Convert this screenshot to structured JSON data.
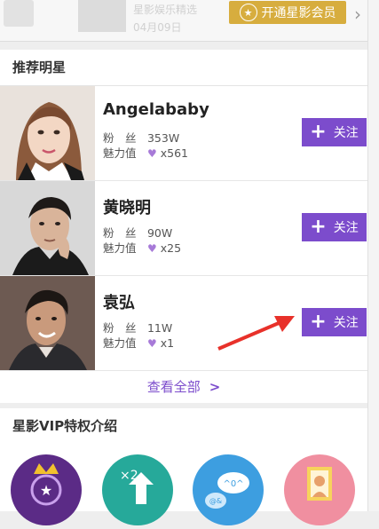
{
  "top": {
    "vip_button_label": "开通星影会员",
    "blurred_line1": "星影娱乐精选",
    "blurred_line2": "04月09日"
  },
  "recommend": {
    "title": "推荐明星",
    "see_all": "查看全部",
    "fans_label": "粉　丝",
    "charm_label": "魅力值",
    "follow_label": "关注",
    "stars": [
      {
        "name": "Angelababy",
        "fans": "353W",
        "charm": "x561"
      },
      {
        "name": "黄晓明",
        "fans": "90W",
        "charm": "x25"
      },
      {
        "name": "袁弘",
        "fans": "11W",
        "charm": "x1"
      }
    ]
  },
  "vip": {
    "title": "星影VIP特权介绍",
    "icon_badge": "×2",
    "chat_text": "^0^",
    "chat_at": "@&",
    "icons": [
      "crown-badge-icon",
      "double-growth-icon",
      "chat-bubble-icon",
      "portrait-frame-icon"
    ]
  },
  "colors": {
    "accent_purple": "#7c4ccc",
    "gold": "#d7ad3e",
    "arrow_red": "#e8312a"
  }
}
